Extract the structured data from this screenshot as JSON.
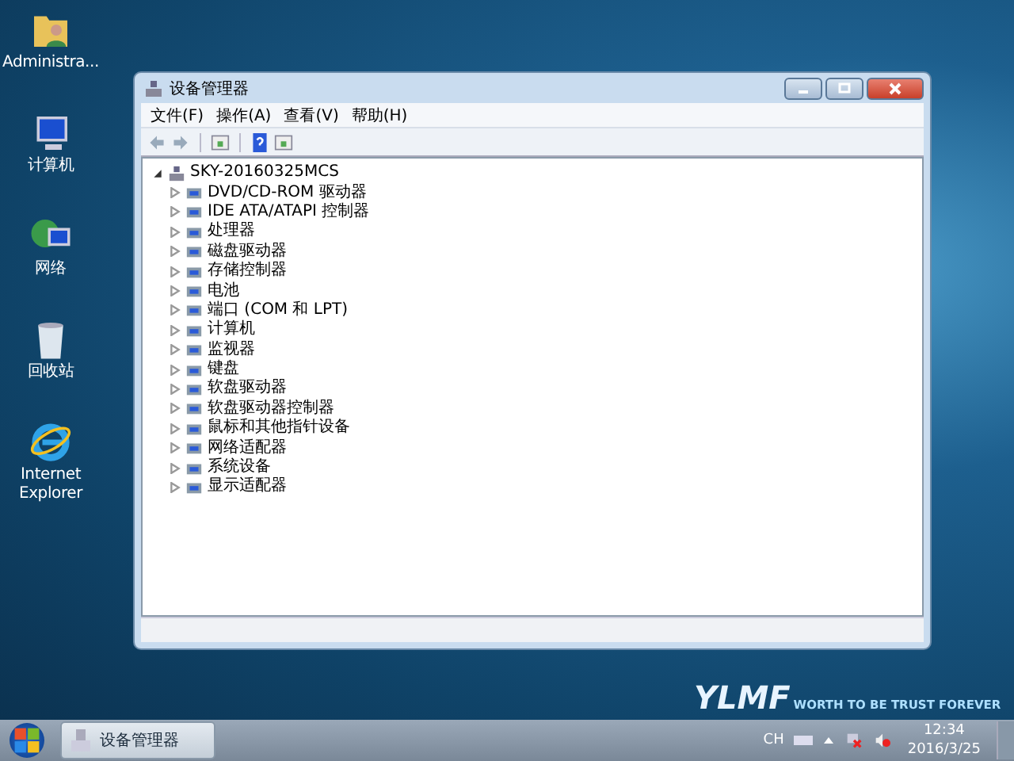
{
  "desktop_icons": [
    {
      "label": "Administra...",
      "kind": "folder"
    },
    {
      "label": "计算机",
      "kind": "computer"
    },
    {
      "label": "网络",
      "kind": "network"
    },
    {
      "label": "回收站",
      "kind": "recycle"
    },
    {
      "label": "Internet Explorer",
      "kind": "ie"
    }
  ],
  "window": {
    "title": "设备管理器",
    "menu": [
      "文件(F)",
      "操作(A)",
      "查看(V)",
      "帮助(H)"
    ],
    "tree": {
      "label": "SKY-20160325MCS",
      "expanded": true,
      "children": [
        {
          "label": "DVD/CD-ROM 驱动器",
          "expanded": false
        },
        {
          "label": "IDE ATA/ATAPI 控制器",
          "expanded": false
        },
        {
          "label": "处理器",
          "expanded": false
        },
        {
          "label": "磁盘驱动器",
          "expanded": false
        },
        {
          "label": "存储控制器",
          "expanded": false
        },
        {
          "label": "电池",
          "expanded": false
        },
        {
          "label": "端口 (COM 和 LPT)",
          "expanded": false
        },
        {
          "label": "计算机",
          "expanded": false
        },
        {
          "label": "监视器",
          "expanded": false
        },
        {
          "label": "键盘",
          "expanded": false
        },
        {
          "label": "软盘驱动器",
          "expanded": false
        },
        {
          "label": "软盘驱动器控制器",
          "expanded": false
        },
        {
          "label": "鼠标和其他指针设备",
          "expanded": false
        },
        {
          "label": "网络适配器",
          "expanded": false
        },
        {
          "label": "系统设备",
          "expanded": false
        },
        {
          "label": "显示适配器",
          "expanded": false
        }
      ]
    }
  },
  "wallpaper_logo": {
    "logo": "YLMF",
    "slogan": "WORTH TO BE TRUST FOREVER"
  },
  "taskbar": {
    "tasks": [
      {
        "label": "设备管理器",
        "selected": true
      }
    ],
    "tray": {
      "language": "CH",
      "time": "12:34",
      "date": "2016/3/25"
    }
  }
}
